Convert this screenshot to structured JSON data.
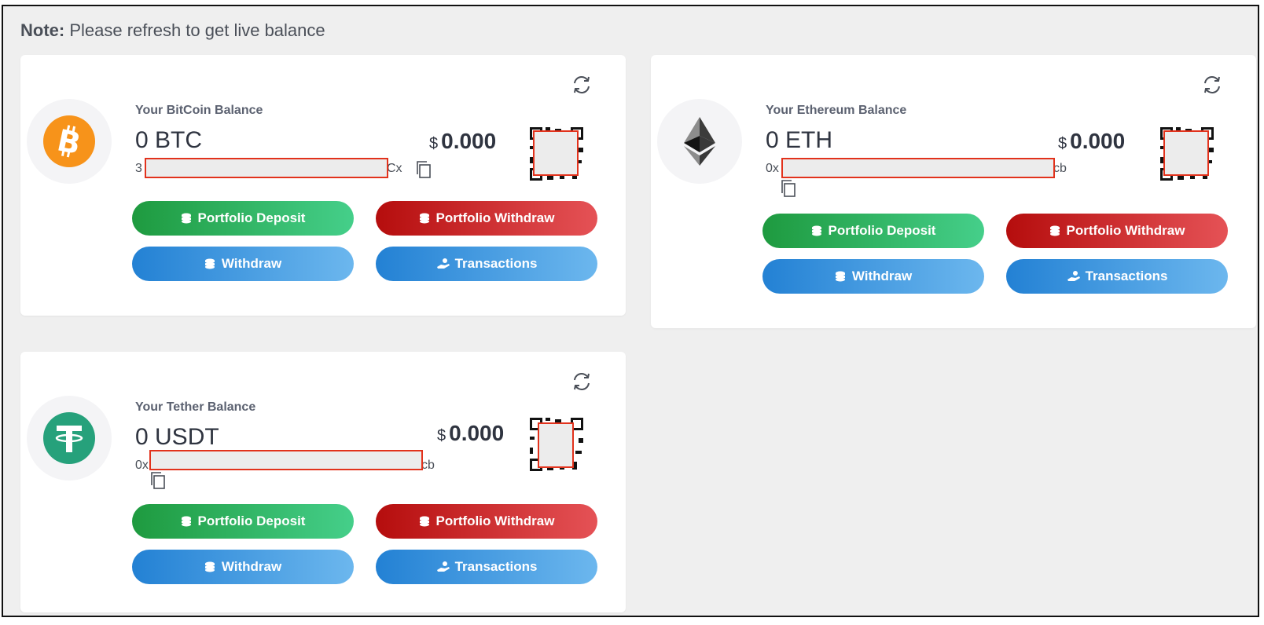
{
  "note": {
    "prefix": "Note:",
    "text": " Please refresh to get live balance"
  },
  "cards": {
    "btc": {
      "label": "Your BitCoin Balance",
      "amount": "0 BTC",
      "usd_symbol": "$",
      "usd_value": "0.000",
      "addr_start": "3",
      "addr_end": "Cx"
    },
    "eth": {
      "label": "Your Ethereum Balance",
      "amount": "0 ETH",
      "usd_symbol": "$",
      "usd_value": "0.000",
      "addr_start": "0x",
      "addr_end": "cb"
    },
    "usdt": {
      "label": "Your Tether Balance",
      "amount": "0 USDT",
      "usd_symbol": "$",
      "usd_value": "0.000",
      "addr_start": "0x",
      "addr_end": "cb"
    }
  },
  "buttons": {
    "deposit": "Portfolio Deposit",
    "withdraw_portfolio": "Portfolio Withdraw",
    "withdraw": "Withdraw",
    "transactions": "Transactions"
  },
  "colors": {
    "green": "#1e9a3f",
    "red": "#b50d0d",
    "blue": "#2381d4",
    "bitcoin": "#f7931a",
    "tether": "#26a17b",
    "mask_border": "#e2321c"
  }
}
